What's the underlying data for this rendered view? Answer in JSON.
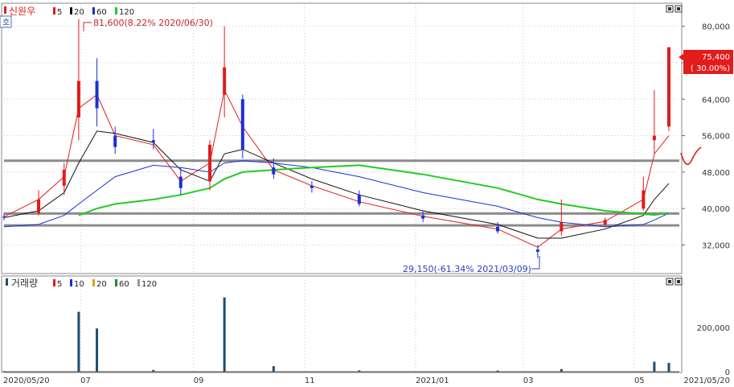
{
  "price_panel": {
    "stock_name": "신원우",
    "legend": [
      {
        "label": "5",
        "color": "#e21b1b"
      },
      {
        "label": "20",
        "color": "#111111"
      },
      {
        "label": "60",
        "color": "#1c2fd6"
      },
      {
        "label": "120",
        "color": "#22cc22"
      }
    ],
    "hi_annotation": "81,600(8.22% 2020/06/30)",
    "lo_annotation": "29,150(-61.34% 2021/03/09)",
    "current_price": "75,400",
    "current_change": "( 30.00%)",
    "side_tag": "호"
  },
  "volume_panel": {
    "title": "거래량",
    "legend": [
      {
        "label": "5",
        "color": "#e21b1b"
      },
      {
        "label": "10",
        "color": "#1c2fd6"
      },
      {
        "label": "20",
        "color": "#e0a000"
      },
      {
        "label": "60",
        "color": "#1e8c1e"
      },
      {
        "label": "120",
        "color": "#999999"
      }
    ]
  },
  "colors": {
    "up": "#e21b1b",
    "down": "#1c2fd6",
    "ma5": "#e21b1b",
    "ma20": "#111111",
    "ma60": "#1c2fd6",
    "ma120": "#22cc22",
    "volume": "#1f4e6e",
    "hline": "#8c8c8c"
  },
  "chart_data": [
    {
      "type": "candlestick",
      "title": "신원우",
      "x_labels": [
        "2020/05/20",
        "07",
        "09",
        "11",
        "2021/01",
        "03",
        "05",
        "2021/05/20"
      ],
      "y_ticks": [
        32000,
        40000,
        48000,
        56000,
        64000,
        72000,
        80000
      ],
      "ylim": [
        27500,
        84000
      ],
      "horizontal_lines": [
        50500,
        38900,
        36300
      ],
      "ohlc": [
        {
          "date": "2020-05-20",
          "open": 38200,
          "high": 39000,
          "low": 37400,
          "close": 38000
        },
        {
          "date": "2020-06-08",
          "open": 39000,
          "high": 44000,
          "low": 38500,
          "close": 42000
        },
        {
          "date": "2020-06-22",
          "open": 45000,
          "high": 50000,
          "low": 43000,
          "close": 48500
        },
        {
          "date": "2020-06-30",
          "open": 60000,
          "high": 81600,
          "low": 55000,
          "close": 68000
        },
        {
          "date": "2020-07-10",
          "open": 68000,
          "high": 73000,
          "low": 58000,
          "close": 62000
        },
        {
          "date": "2020-07-20",
          "open": 56000,
          "high": 58000,
          "low": 52000,
          "close": 53500
        },
        {
          "date": "2020-08-10",
          "open": 55000,
          "high": 57500,
          "low": 53000,
          "close": 54500
        },
        {
          "date": "2020-08-25",
          "open": 47000,
          "high": 49000,
          "low": 43000,
          "close": 44500
        },
        {
          "date": "2020-09-10",
          "open": 46000,
          "high": 55000,
          "low": 44000,
          "close": 54000
        },
        {
          "date": "2020-09-18",
          "open": 65000,
          "high": 80000,
          "low": 60000,
          "close": 71000
        },
        {
          "date": "2020-09-28",
          "open": 64000,
          "high": 65000,
          "low": 51000,
          "close": 53000
        },
        {
          "date": "2020-10-15",
          "open": 49000,
          "high": 51000,
          "low": 46500,
          "close": 47500
        },
        {
          "date": "2020-11-05",
          "open": 45000,
          "high": 46000,
          "low": 43500,
          "close": 44500
        },
        {
          "date": "2020-12-01",
          "open": 43000,
          "high": 44000,
          "low": 40500,
          "close": 41000
        },
        {
          "date": "2021-01-05",
          "open": 38500,
          "high": 39500,
          "low": 37000,
          "close": 37800
        },
        {
          "date": "2021-02-15",
          "open": 36000,
          "high": 37000,
          "low": 34500,
          "close": 35000
        },
        {
          "date": "2021-03-09",
          "open": 31000,
          "high": 32000,
          "low": 29150,
          "close": 30500
        },
        {
          "date": "2021-03-22",
          "open": 35000,
          "high": 42000,
          "low": 34000,
          "close": 37000
        },
        {
          "date": "2021-04-15",
          "open": 36500,
          "high": 38000,
          "low": 36000,
          "close": 37500
        },
        {
          "date": "2021-05-06",
          "open": 40000,
          "high": 47000,
          "low": 39500,
          "close": 44000
        },
        {
          "date": "2021-05-12",
          "open": 55000,
          "high": 66000,
          "low": 52000,
          "close": 56000
        },
        {
          "date": "2021-05-20",
          "open": 58000,
          "high": 75400,
          "low": 57000,
          "close": 75400
        }
      ],
      "series": [
        {
          "name": "5",
          "values": [
            38200,
            42000,
            47000,
            62000,
            65000,
            56000,
            54000,
            46000,
            50000,
            66000,
            58000,
            48500,
            45000,
            41500,
            38300,
            35500,
            31500,
            35500,
            37200,
            42000,
            52000,
            56000
          ]
        },
        {
          "name": "20",
          "values": [
            38000,
            39500,
            43500,
            50000,
            57000,
            56500,
            54500,
            48500,
            46000,
            52000,
            53000,
            50000,
            46500,
            43000,
            39500,
            36500,
            33500,
            33500,
            35500,
            38500,
            42000,
            45500
          ]
        },
        {
          "name": "60",
          "values": [
            36000,
            36500,
            38500,
            41000,
            44000,
            47000,
            49500,
            49000,
            48000,
            50000,
            50500,
            50000,
            49000,
            47000,
            43500,
            40500,
            38000,
            37000,
            36000,
            36500,
            37500,
            39000
          ]
        },
        {
          "name": "120",
          "values": [
            null,
            null,
            null,
            38500,
            40000,
            41000,
            42000,
            43000,
            44500,
            46500,
            48000,
            48500,
            49000,
            49500,
            47500,
            44500,
            42000,
            41000,
            39500,
            38800,
            38600,
            39000
          ]
        }
      ]
    },
    {
      "type": "bar",
      "title": "거래량",
      "y_ticks": [
        0,
        200000
      ],
      "ylim": [
        0,
        370000
      ],
      "categories": [
        "2020-05-20",
        "2020-06-30",
        "2020-07-10",
        "2020-08-10",
        "2020-09-18",
        "2020-10-15",
        "2020-12-01",
        "2021-02-15",
        "2021-03-22",
        "2021-05-12",
        "2021-05-20"
      ],
      "values": [
        3000,
        270000,
        195000,
        8000,
        335000,
        25000,
        6000,
        5000,
        12000,
        45000,
        40000
      ]
    }
  ]
}
